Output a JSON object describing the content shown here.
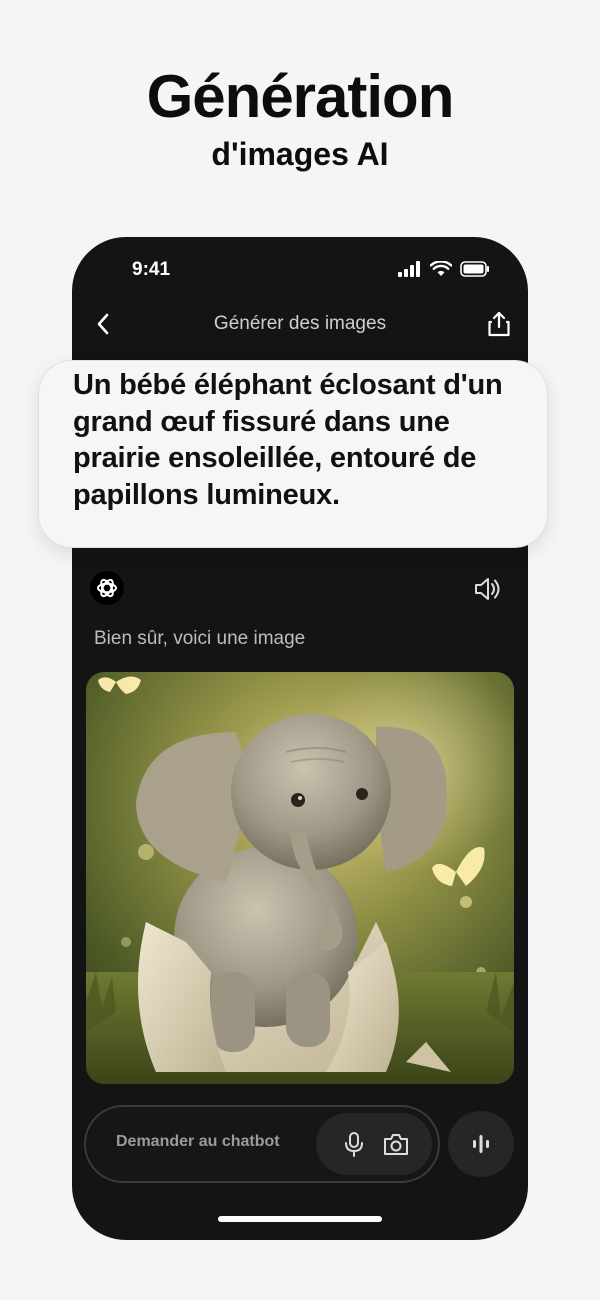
{
  "hero": {
    "title": "Génération",
    "subtitle": "d'images AI"
  },
  "status_bar": {
    "time": "9:41",
    "icons": [
      "signal-icon",
      "wifi-icon",
      "battery-icon"
    ]
  },
  "nav": {
    "back_icon": "chevron-left-icon",
    "title": "Générer des images",
    "share_icon": "share-icon"
  },
  "prompt": {
    "text": "Un bébé éléphant éclosant d'un grand œuf fissuré dans une prairie ensoleillée, entouré de papillons lumineux."
  },
  "bot_message": {
    "avatar_icon": "chatbot-logo-icon",
    "speaker_icon": "speaker-icon",
    "text": "Bien sûr, voici une image"
  },
  "generated_image": {
    "subject": "baby elephant hatching from cracked egg in sunny meadow with glowing butterflies"
  },
  "composer": {
    "placeholder": "Demander au chatbot",
    "mic_icon": "microphone-icon",
    "camera_icon": "camera-icon",
    "voice_icon": "voice-wave-icon"
  },
  "colors": {
    "page_bg": "#f6f5f3",
    "phone_bg": "#141414",
    "bubble_bg": "#f7f6f4",
    "accent_glow": "#f3d27a"
  }
}
